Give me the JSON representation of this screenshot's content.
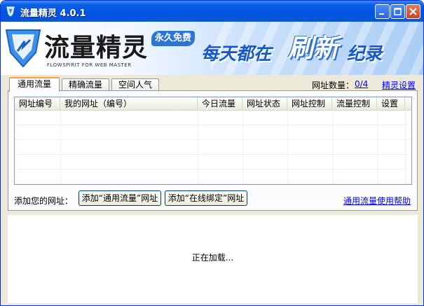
{
  "window": {
    "title": "流量精灵 4.0.1"
  },
  "banner": {
    "brand_name": "流量精灵",
    "brand_sub": "FLOWSPIRIT FOR WEB MASTER",
    "free_badge": "永久免费",
    "slogan_a": "每天都在",
    "slogan_b": "刷新",
    "slogan_c": "纪录"
  },
  "tabs": [
    {
      "label": "通用流量",
      "active": true
    },
    {
      "label": "精确流量",
      "active": false
    },
    {
      "label": "空间人气",
      "active": false
    }
  ],
  "header_right": {
    "url_count_label": "网址数量：",
    "url_count": "0/4",
    "settings_link": "精灵设置"
  },
  "table": {
    "columns": [
      "网址编号",
      "我的网址（编号）",
      "今日流量",
      "网址状态",
      "网址控制",
      "流量控制",
      "设置"
    ],
    "rows": []
  },
  "add_bar": {
    "label": "添加您的网址：",
    "add_general_button": "添加“通用流量”网址",
    "add_bound_button": "添加“在线绑定”网址",
    "help_link": "通用流量使用帮助"
  },
  "content": {
    "loading_text": "正在加载..."
  },
  "colors": {
    "title_bar": "#0054e3",
    "link": "#0000ff",
    "tab_highlight": "#f7a13d",
    "brand_blue": "#1558c9"
  }
}
